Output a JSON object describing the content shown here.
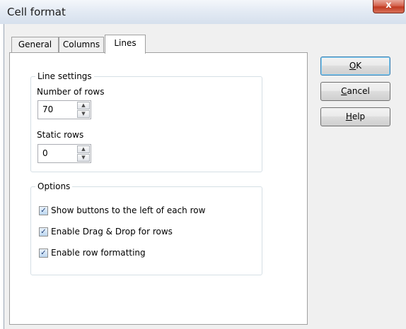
{
  "window": {
    "title": "Cell format",
    "close_glyph": "x"
  },
  "tabs": [
    {
      "label": "General",
      "active": false
    },
    {
      "label": "Columns",
      "active": false
    },
    {
      "label": "Lines",
      "active": true
    }
  ],
  "line_settings": {
    "legend": "Line settings",
    "number_of_rows": {
      "label": "Number of rows",
      "value": "70"
    },
    "static_rows": {
      "label": "Static rows",
      "value": "0"
    }
  },
  "options": {
    "legend": "Options",
    "items": [
      {
        "label": "Show buttons to the left of each row",
        "checked": true
      },
      {
        "label": "Enable Drag & Drop for rows",
        "checked": true
      },
      {
        "label": "Enable row formatting",
        "checked": true
      }
    ]
  },
  "buttons": {
    "ok": {
      "mnemonic": "O",
      "rest": "K"
    },
    "cancel": {
      "mnemonic": "C",
      "rest": "ancel"
    },
    "help": {
      "mnemonic": "H",
      "rest": "elp"
    }
  },
  "icons": {
    "spin_up": "up-arrow-icon",
    "spin_down": "down-arrow-icon",
    "check": "checkmark-icon"
  }
}
